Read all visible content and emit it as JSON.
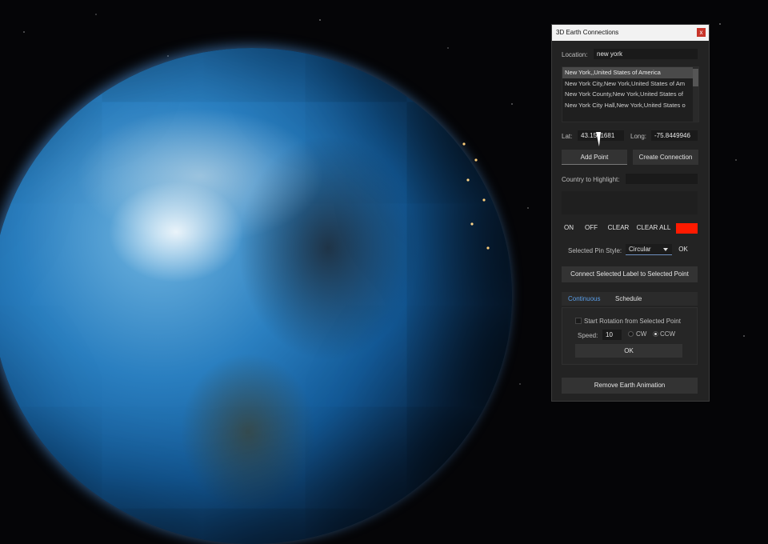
{
  "window": {
    "title": "3D Earth Connections",
    "close_glyph": "x"
  },
  "location": {
    "label": "Location:",
    "value": "new york"
  },
  "results": [
    "New York,,United States of America",
    "New York City,New York,United States of Am",
    "New York County,New York,United States of",
    "New York City Hall,New York,United States o"
  ],
  "coords": {
    "lat_label": "Lat:",
    "lat_value": "43.1561681",
    "long_label": "Long:",
    "long_value": "-75.8449946"
  },
  "buttons": {
    "add_point": "Add Point",
    "create_connection": "Create Connection",
    "on": "ON",
    "off": "OFF",
    "clear": "CLEAR",
    "clear_all": "CLEAR ALL",
    "ok_pin": "OK",
    "connect_label": "Connect Selected Label to Selected Point",
    "ok_rotation": "OK",
    "remove_animation": "Remove Earth Animation"
  },
  "country": {
    "label": "Country to Highlight:",
    "value": ""
  },
  "highlight_color": "#ff1a00",
  "pin_style": {
    "label": "Selected Pin Style:",
    "value": "Circular"
  },
  "tabs": {
    "continuous": "Continuous",
    "schedule": "Schedule"
  },
  "rotation": {
    "start_label": "Start Rotation from Selected Point",
    "speed_label": "Speed:",
    "speed_value": "10",
    "cw_label": "CW",
    "ccw_label": "CCW"
  }
}
